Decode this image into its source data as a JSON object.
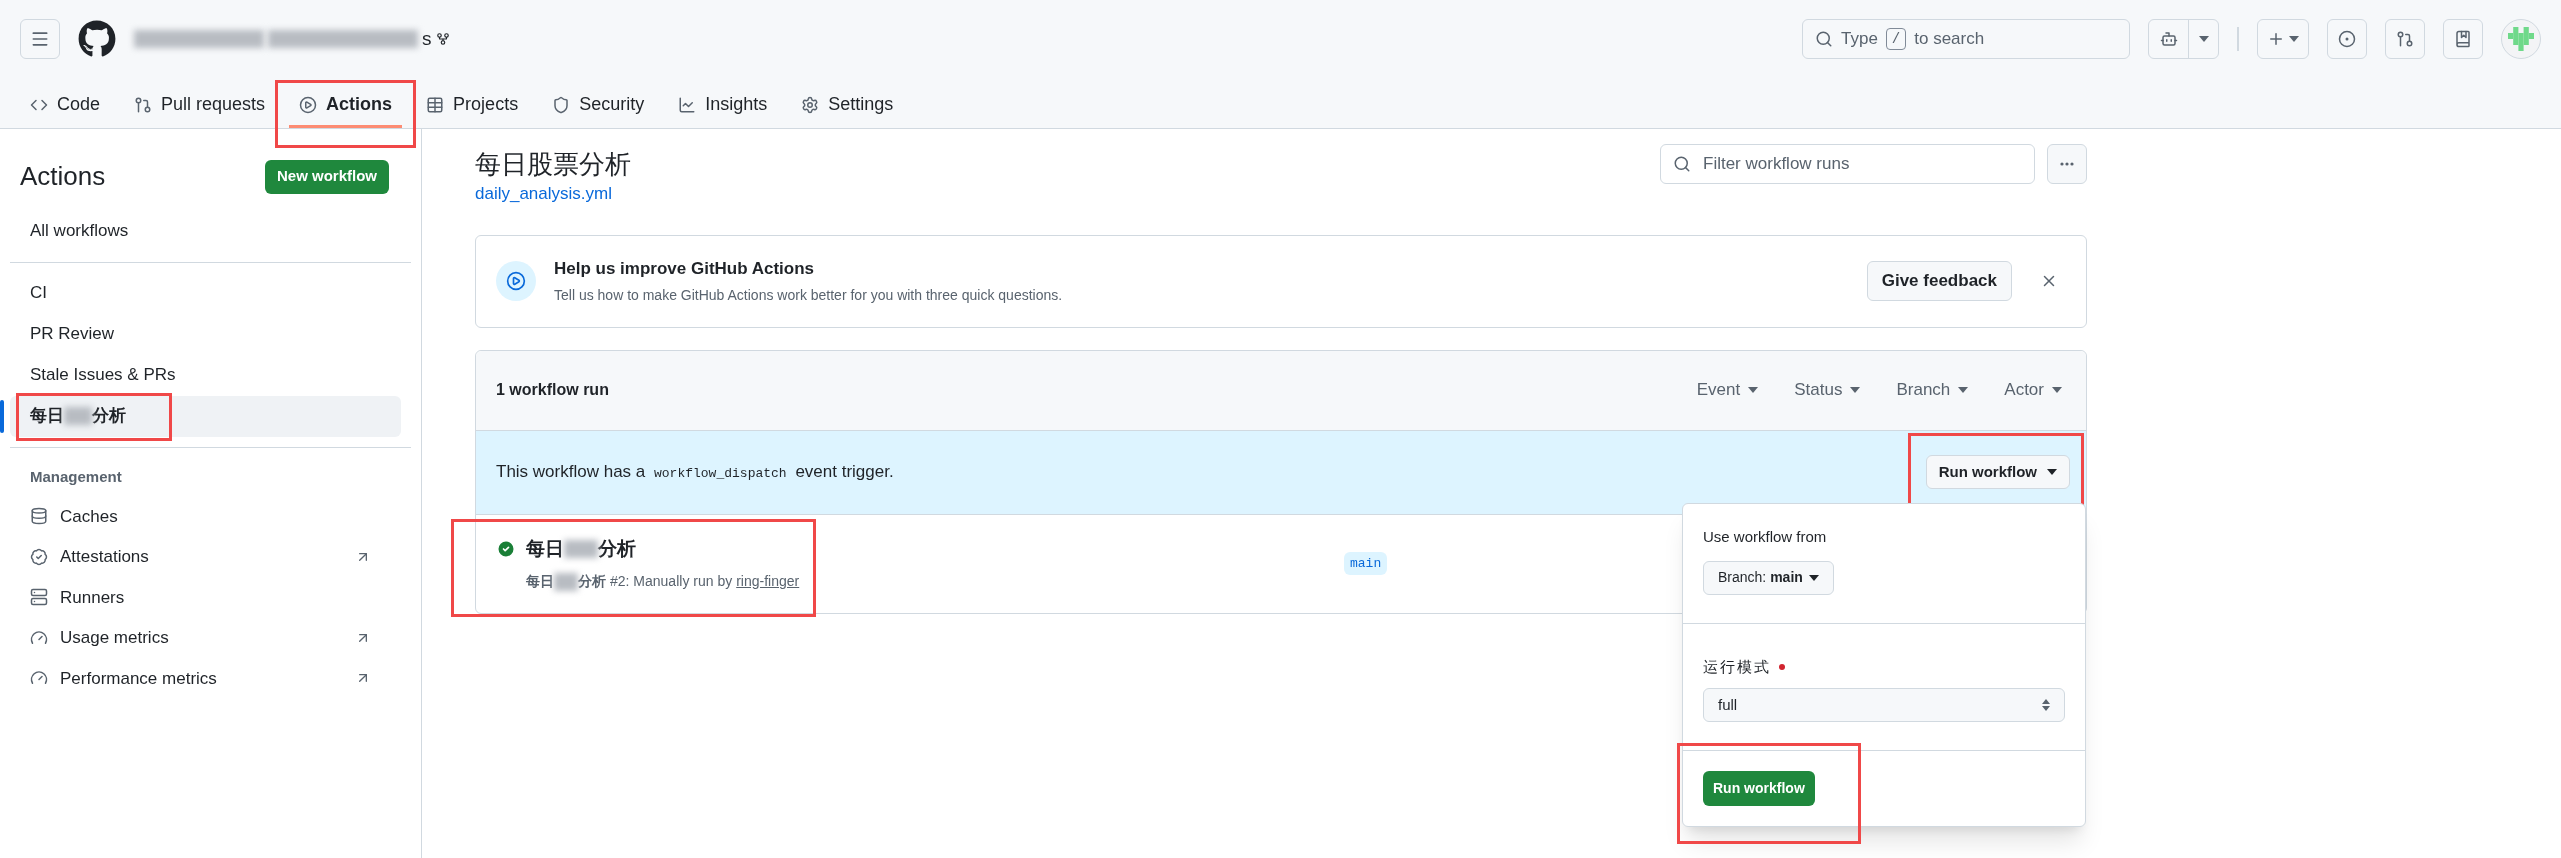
{
  "header": {
    "repo": {
      "redacted": true,
      "visible_tail": "s"
    },
    "search": {
      "placeholder_before": "Type",
      "shortcut": "/",
      "placeholder_after": "to search"
    }
  },
  "tabs": [
    {
      "label": "Code",
      "selected": false,
      "highlighted": false
    },
    {
      "label": "Pull requests",
      "selected": false,
      "highlighted": false
    },
    {
      "label": "Actions",
      "selected": true,
      "highlighted": true
    },
    {
      "label": "Projects",
      "selected": false,
      "highlighted": false
    },
    {
      "label": "Security",
      "selected": false,
      "highlighted": false
    },
    {
      "label": "Insights",
      "selected": false,
      "highlighted": false
    },
    {
      "label": "Settings",
      "selected": false,
      "highlighted": false
    }
  ],
  "sidebar": {
    "title": "Actions",
    "new_button": "New workflow",
    "all_workflows": "All workflows",
    "workflows": [
      {
        "label": "CI",
        "selected": false,
        "highlighted": false
      },
      {
        "label": "PR Review",
        "selected": false,
        "highlighted": false
      },
      {
        "label": "Stale Issues & PRs",
        "selected": false,
        "highlighted": false
      },
      {
        "label": "每日",
        "redacted": true,
        "label_after": "分析",
        "selected": true,
        "highlighted": true
      }
    ],
    "management_title": "Management",
    "management": [
      {
        "label": "Caches",
        "external": false
      },
      {
        "label": "Attestations",
        "external": true
      },
      {
        "label": "Runners",
        "external": false
      },
      {
        "label": "Usage metrics",
        "external": true
      },
      {
        "label": "Performance metrics",
        "external": true
      }
    ]
  },
  "main": {
    "title": "每日股票分析",
    "file_link": "daily_analysis.yml",
    "filter": {
      "placeholder": "Filter workflow runs"
    },
    "feedback": {
      "title": "Help us improve GitHub Actions",
      "text": "Tell us how to make GitHub Actions work better for you with three quick questions.",
      "button": "Give feedback"
    },
    "runs": {
      "count": "1 workflow run",
      "filters": [
        "Event",
        "Status",
        "Branch",
        "Actor"
      ],
      "banner": {
        "before": "This workflow has a",
        "code": "workflow_dispatch",
        "after": "event trigger.",
        "button": "Run workflow",
        "highlighted": true
      },
      "items": [
        {
          "succeeded": true,
          "title": "每日",
          "title_redacted": true,
          "title_after": "分析",
          "sub_name": "每日",
          "sub_redacted": true,
          "sub_name_after": "分析",
          "sub_text": "#2: Manually run by",
          "actor": "ring-finger",
          "branch": "main",
          "highlighted": true
        }
      ]
    },
    "dropdown": {
      "open": true,
      "from_label": "Use workflow from",
      "branch_button": "Branch: **main**",
      "input_label": "运行模式",
      "required": true,
      "select_value": "full",
      "submit": "Run workflow",
      "submit_highlighted": true
    }
  }
}
